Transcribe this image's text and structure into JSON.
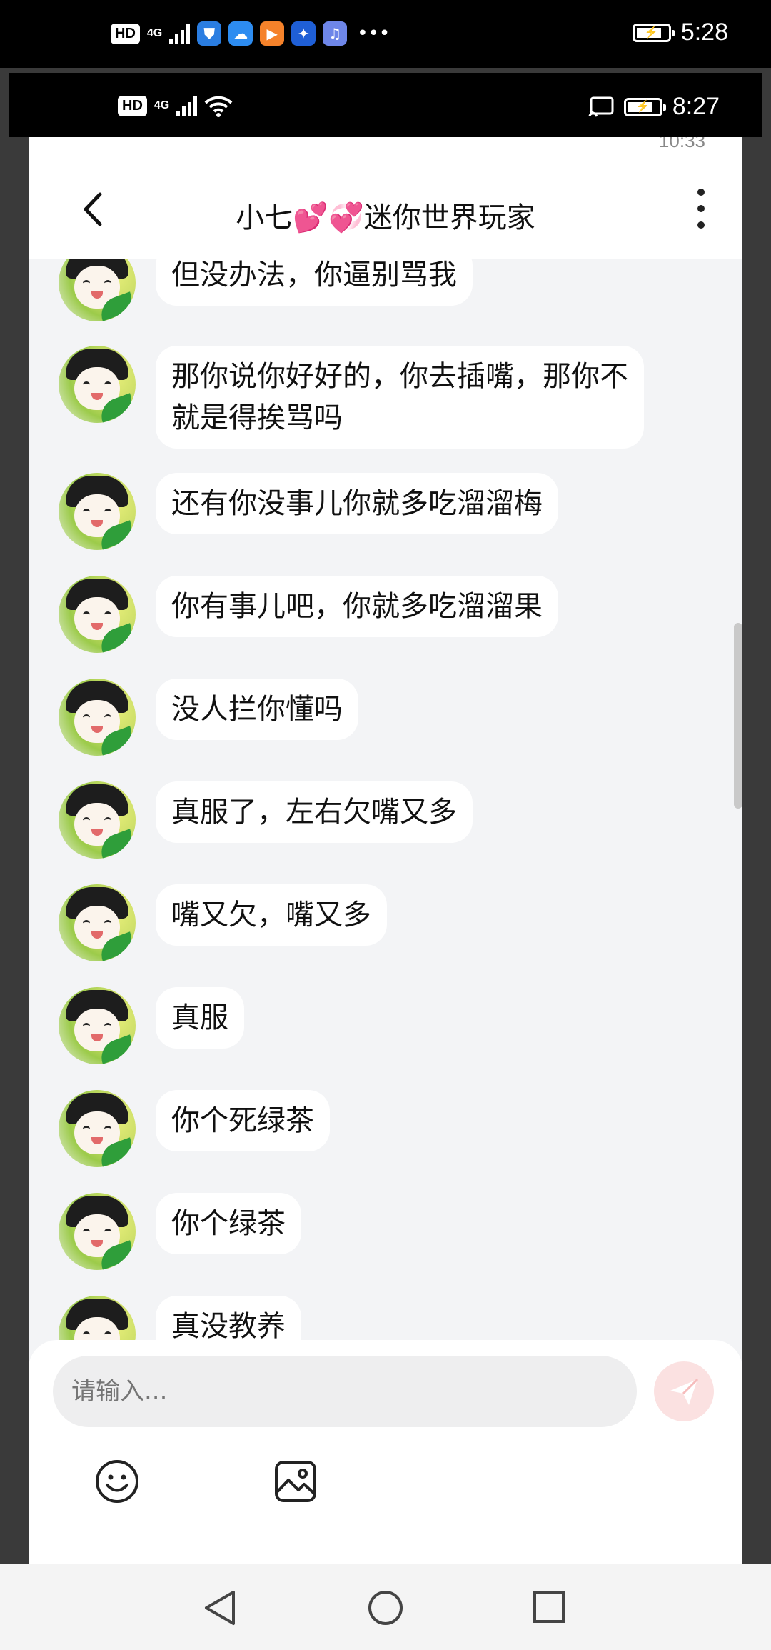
{
  "outer_status": {
    "hd": "HD",
    "network": "4G",
    "time": "5:28"
  },
  "inner_status": {
    "hd": "HD",
    "network": "4G",
    "time": "8:27"
  },
  "ghost_status": {
    "time": "10:33"
  },
  "header": {
    "title": "小七💕💞迷你世界玩家"
  },
  "messages": [
    {
      "text": "但没办法，你逼别骂我"
    },
    {
      "text": "那你说你好好的，你去插嘴，那你不就是得挨骂吗"
    },
    {
      "text": "还有你没事儿你就多吃溜溜梅"
    },
    {
      "text": "你有事儿吧，你就多吃溜溜果"
    },
    {
      "text": "没人拦你懂吗"
    },
    {
      "text": "真服了，左右欠嘴又多"
    },
    {
      "text": "嘴又欠，嘴又多"
    },
    {
      "text": "真服"
    },
    {
      "text": "你个死绿茶"
    },
    {
      "text": "你个绿茶"
    },
    {
      "text": "真没教养"
    }
  ],
  "composer": {
    "placeholder": "请输入..."
  },
  "icons": {
    "back": "chevron-left-icon",
    "more": "more-vertical-icon",
    "send": "send-icon",
    "emoji": "smile-icon",
    "image": "image-icon"
  },
  "colors": {
    "send_button": "#fbe1e1",
    "accent": "#f07070",
    "background": "#f3f4f6"
  }
}
